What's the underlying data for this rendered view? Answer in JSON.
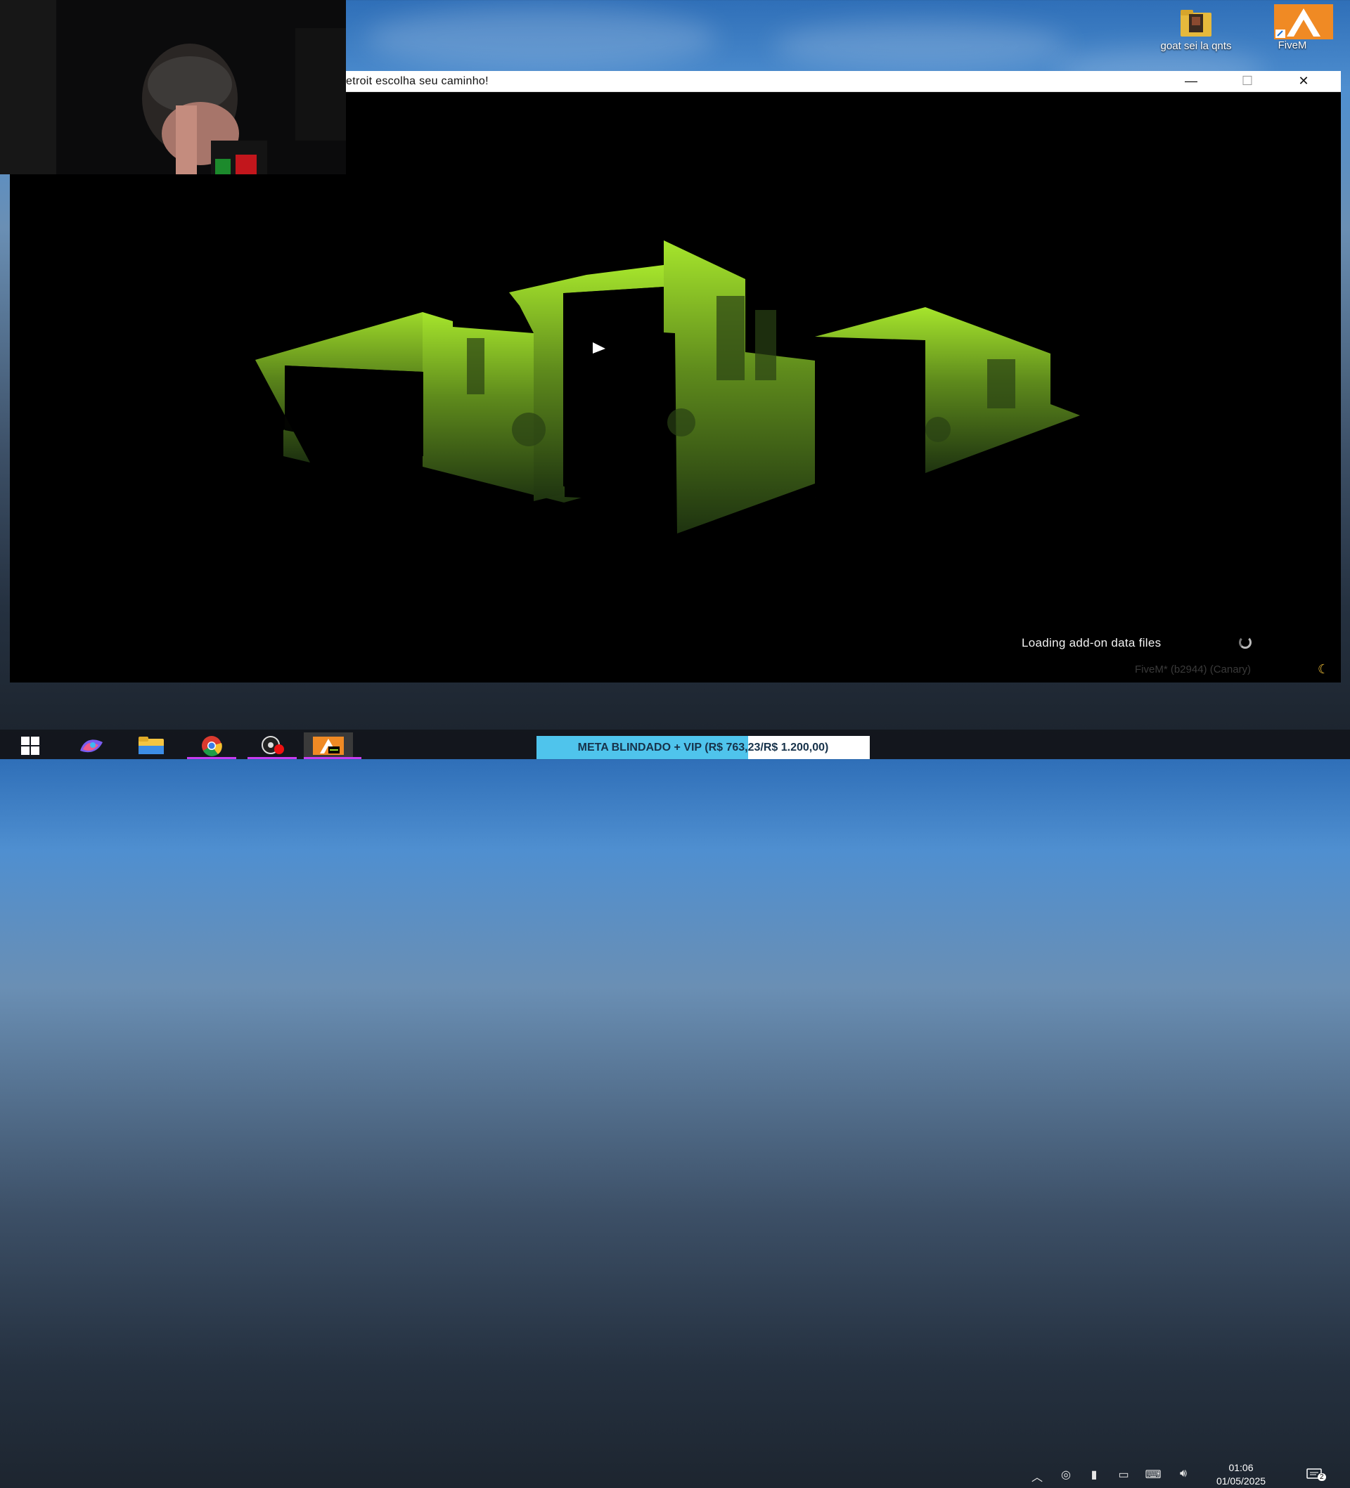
{
  "desktop": {
    "icons": [
      {
        "label": "goat sei la qnts",
        "icon": "folder-icon"
      },
      {
        "label": "FiveM",
        "icon": "fivem-shortcut-icon"
      }
    ]
  },
  "window": {
    "title": "etroit escolha seu caminho!",
    "controls": {
      "minimize": "—",
      "maximize": "☐",
      "close": "✕"
    }
  },
  "loading": {
    "status_text": "Loading add-on data files",
    "version_text": "FiveM* (b2944) (Canary)"
  },
  "taskbar": {
    "apps": [
      "windows-start-icon",
      "copilot-icon",
      "file-explorer-icon",
      "chrome-icon",
      "obs-icon",
      "fivem-app-icon"
    ],
    "goal_widget": {
      "text": "META BLINDADO + VIP (R$ 763,23/R$ 1.200,00)",
      "current": 763.23,
      "goal": 1200.0,
      "accent": "#4fc4ec"
    },
    "clock": {
      "time": "01:06",
      "date": "01/05/2025"
    },
    "notifications": "2"
  },
  "colors": {
    "logo_green": "#9fe029",
    "window_bg": "#000000",
    "taskbar_bg": "#12161c"
  }
}
